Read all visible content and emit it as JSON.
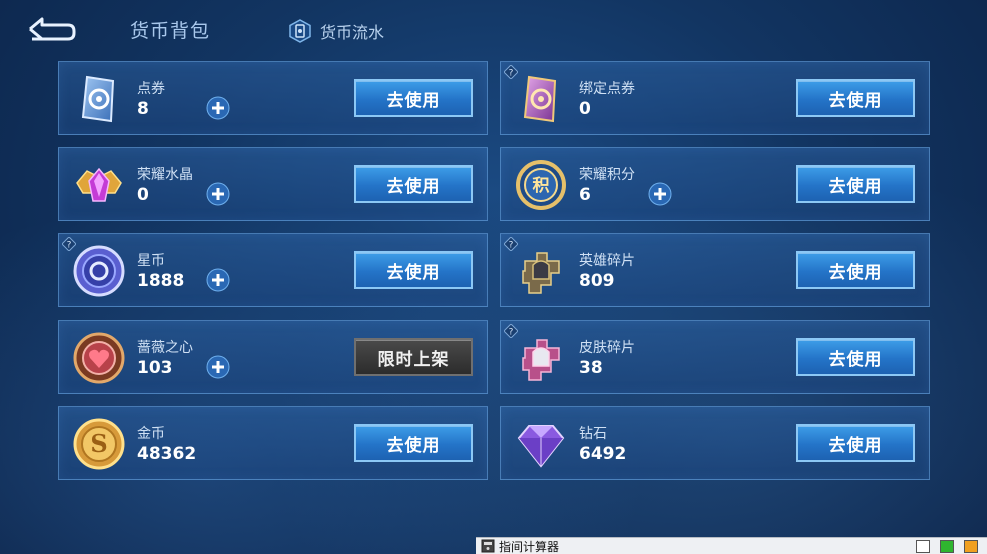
{
  "header": {
    "title": "货币背包",
    "flow_tab": "货币流水"
  },
  "cards": [
    {
      "name": "点券",
      "value": "8",
      "button": "去使用",
      "has_plus": true,
      "icon": "coupon-ticket-icon"
    },
    {
      "name": "绑定点券",
      "value": "0",
      "button": "去使用",
      "has_plus": false,
      "icon": "bound-coupon-icon"
    },
    {
      "name": "荣耀水晶",
      "value": "0",
      "button": "去使用",
      "has_plus": true,
      "icon": "glory-crystal-icon"
    },
    {
      "name": "荣耀积分",
      "value": "6",
      "button": "去使用",
      "has_plus": true,
      "icon": "glory-points-icon"
    },
    {
      "name": "星币",
      "value": "1888",
      "button": "去使用",
      "has_plus": true,
      "icon": "star-coin-icon"
    },
    {
      "name": "英雄碎片",
      "value": "809",
      "button": "去使用",
      "has_plus": false,
      "icon": "hero-fragment-icon"
    },
    {
      "name": "蔷薇之心",
      "value": "103",
      "button": "限时上架",
      "has_plus": true,
      "icon": "rose-heart-icon"
    },
    {
      "name": "皮肤碎片",
      "value": "38",
      "button": "去使用",
      "has_plus": false,
      "icon": "skin-fragment-icon"
    },
    {
      "name": "金币",
      "value": "48362",
      "button": "去使用",
      "has_plus": false,
      "icon": "gold-coin-icon"
    },
    {
      "name": "钻石",
      "value": "6492",
      "button": "去使用",
      "has_plus": false,
      "icon": "diamond-icon"
    }
  ],
  "taskbar": {
    "app_name": "指间计算器"
  },
  "colors": {
    "accent_button": "#2a80d0",
    "disabled_button": "#3a3a3a",
    "background": "#123562"
  }
}
